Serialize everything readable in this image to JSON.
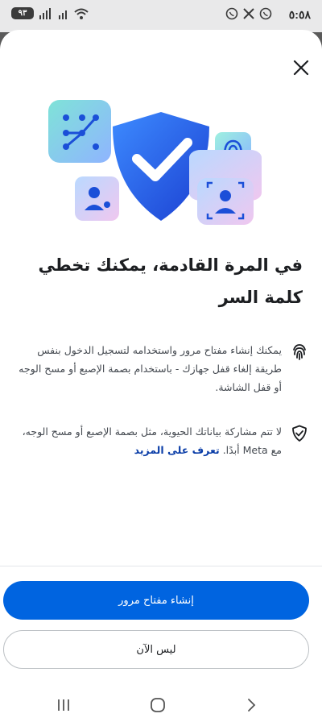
{
  "status_bar": {
    "time": "٥:٥٨",
    "battery": "٩٣",
    "icons": [
      "whatsapp-icon",
      "x-icon",
      "whatsapp-business-icon",
      "signal-icon",
      "wifi-icon",
      "battery-icon"
    ]
  },
  "sheet": {
    "close_icon": "close-icon",
    "hero_icons": [
      "shield-check-icon",
      "pattern-lock-icon",
      "fingerprint-icon",
      "face-id-icon",
      "user-key-icon"
    ],
    "title": "في المرة القادمة، يمكنك تخطي كلمة السر",
    "info": [
      {
        "icon": "fingerprint-icon",
        "text": "يمكنك إنشاء مفتاح مرور واستخدامه لتسجيل الدخول بنفس طريقة إلغاء قفل جهازك - باستخدام بصمة الإصبع أو مسح الوجه أو قفل الشاشة."
      },
      {
        "icon": "shield-check-icon",
        "text": "لا تتم مشاركة بياناتك الحيوية، مثل بصمة الإصبع أو مسح الوجه، مع Meta أبدًا.",
        "link": "تعرف على المزيد"
      }
    ],
    "primary_button": "إنشاء مفتاح مرور",
    "secondary_button": "ليس الآن"
  },
  "navbar": {
    "icons": [
      "recent-apps-icon",
      "home-icon",
      "back-icon"
    ]
  },
  "colors": {
    "primary": "#0064e0",
    "link": "#0b3ea8",
    "text": "#1c1e21",
    "muted_text": "#444950"
  }
}
